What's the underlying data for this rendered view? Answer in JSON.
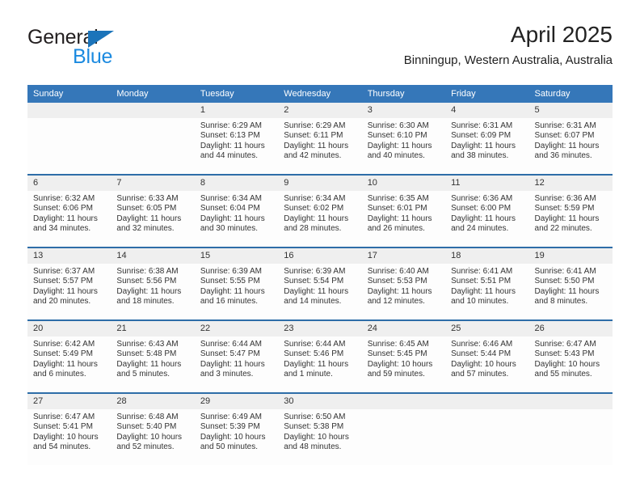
{
  "brand": {
    "name_top": "General",
    "name_bottom": "Blue",
    "accent_dark": "#1b74ba",
    "accent_light": "#1b8ae0"
  },
  "header": {
    "title": "April 2025",
    "subtitle": "Binningup, Western Australia, Australia"
  },
  "theme": {
    "header_bg": "#3577b9",
    "row_border": "#2e6da8",
    "daynum_bg": "#efefef",
    "text": "#333333"
  },
  "weekday_headers": [
    "Sunday",
    "Monday",
    "Tuesday",
    "Wednesday",
    "Thursday",
    "Friday",
    "Saturday"
  ],
  "labels": {
    "sunrise_prefix": "Sunrise:",
    "sunset_prefix": "Sunset:",
    "daylight_prefix": "Daylight:"
  },
  "weeks": [
    [
      {
        "day": "",
        "empty": true
      },
      {
        "day": "",
        "empty": true
      },
      {
        "day": "1",
        "sunrise": "Sunrise: 6:29 AM",
        "sunset": "Sunset: 6:13 PM",
        "daylight_line1": "Daylight: 11 hours",
        "daylight_line2": "and 44 minutes."
      },
      {
        "day": "2",
        "sunrise": "Sunrise: 6:29 AM",
        "sunset": "Sunset: 6:11 PM",
        "daylight_line1": "Daylight: 11 hours",
        "daylight_line2": "and 42 minutes."
      },
      {
        "day": "3",
        "sunrise": "Sunrise: 6:30 AM",
        "sunset": "Sunset: 6:10 PM",
        "daylight_line1": "Daylight: 11 hours",
        "daylight_line2": "and 40 minutes."
      },
      {
        "day": "4",
        "sunrise": "Sunrise: 6:31 AM",
        "sunset": "Sunset: 6:09 PM",
        "daylight_line1": "Daylight: 11 hours",
        "daylight_line2": "and 38 minutes."
      },
      {
        "day": "5",
        "sunrise": "Sunrise: 6:31 AM",
        "sunset": "Sunset: 6:07 PM",
        "daylight_line1": "Daylight: 11 hours",
        "daylight_line2": "and 36 minutes."
      }
    ],
    [
      {
        "day": "6",
        "sunrise": "Sunrise: 6:32 AM",
        "sunset": "Sunset: 6:06 PM",
        "daylight_line1": "Daylight: 11 hours",
        "daylight_line2": "and 34 minutes."
      },
      {
        "day": "7",
        "sunrise": "Sunrise: 6:33 AM",
        "sunset": "Sunset: 6:05 PM",
        "daylight_line1": "Daylight: 11 hours",
        "daylight_line2": "and 32 minutes."
      },
      {
        "day": "8",
        "sunrise": "Sunrise: 6:34 AM",
        "sunset": "Sunset: 6:04 PM",
        "daylight_line1": "Daylight: 11 hours",
        "daylight_line2": "and 30 minutes."
      },
      {
        "day": "9",
        "sunrise": "Sunrise: 6:34 AM",
        "sunset": "Sunset: 6:02 PM",
        "daylight_line1": "Daylight: 11 hours",
        "daylight_line2": "and 28 minutes."
      },
      {
        "day": "10",
        "sunrise": "Sunrise: 6:35 AM",
        "sunset": "Sunset: 6:01 PM",
        "daylight_line1": "Daylight: 11 hours",
        "daylight_line2": "and 26 minutes."
      },
      {
        "day": "11",
        "sunrise": "Sunrise: 6:36 AM",
        "sunset": "Sunset: 6:00 PM",
        "daylight_line1": "Daylight: 11 hours",
        "daylight_line2": "and 24 minutes."
      },
      {
        "day": "12",
        "sunrise": "Sunrise: 6:36 AM",
        "sunset": "Sunset: 5:59 PM",
        "daylight_line1": "Daylight: 11 hours",
        "daylight_line2": "and 22 minutes."
      }
    ],
    [
      {
        "day": "13",
        "sunrise": "Sunrise: 6:37 AM",
        "sunset": "Sunset: 5:57 PM",
        "daylight_line1": "Daylight: 11 hours",
        "daylight_line2": "and 20 minutes."
      },
      {
        "day": "14",
        "sunrise": "Sunrise: 6:38 AM",
        "sunset": "Sunset: 5:56 PM",
        "daylight_line1": "Daylight: 11 hours",
        "daylight_line2": "and 18 minutes."
      },
      {
        "day": "15",
        "sunrise": "Sunrise: 6:39 AM",
        "sunset": "Sunset: 5:55 PM",
        "daylight_line1": "Daylight: 11 hours",
        "daylight_line2": "and 16 minutes."
      },
      {
        "day": "16",
        "sunrise": "Sunrise: 6:39 AM",
        "sunset": "Sunset: 5:54 PM",
        "daylight_line1": "Daylight: 11 hours",
        "daylight_line2": "and 14 minutes."
      },
      {
        "day": "17",
        "sunrise": "Sunrise: 6:40 AM",
        "sunset": "Sunset: 5:53 PM",
        "daylight_line1": "Daylight: 11 hours",
        "daylight_line2": "and 12 minutes."
      },
      {
        "day": "18",
        "sunrise": "Sunrise: 6:41 AM",
        "sunset": "Sunset: 5:51 PM",
        "daylight_line1": "Daylight: 11 hours",
        "daylight_line2": "and 10 minutes."
      },
      {
        "day": "19",
        "sunrise": "Sunrise: 6:41 AM",
        "sunset": "Sunset: 5:50 PM",
        "daylight_line1": "Daylight: 11 hours",
        "daylight_line2": "and 8 minutes."
      }
    ],
    [
      {
        "day": "20",
        "sunrise": "Sunrise: 6:42 AM",
        "sunset": "Sunset: 5:49 PM",
        "daylight_line1": "Daylight: 11 hours",
        "daylight_line2": "and 6 minutes."
      },
      {
        "day": "21",
        "sunrise": "Sunrise: 6:43 AM",
        "sunset": "Sunset: 5:48 PM",
        "daylight_line1": "Daylight: 11 hours",
        "daylight_line2": "and 5 minutes."
      },
      {
        "day": "22",
        "sunrise": "Sunrise: 6:44 AM",
        "sunset": "Sunset: 5:47 PM",
        "daylight_line1": "Daylight: 11 hours",
        "daylight_line2": "and 3 minutes."
      },
      {
        "day": "23",
        "sunrise": "Sunrise: 6:44 AM",
        "sunset": "Sunset: 5:46 PM",
        "daylight_line1": "Daylight: 11 hours",
        "daylight_line2": "and 1 minute."
      },
      {
        "day": "24",
        "sunrise": "Sunrise: 6:45 AM",
        "sunset": "Sunset: 5:45 PM",
        "daylight_line1": "Daylight: 10 hours",
        "daylight_line2": "and 59 minutes."
      },
      {
        "day": "25",
        "sunrise": "Sunrise: 6:46 AM",
        "sunset": "Sunset: 5:44 PM",
        "daylight_line1": "Daylight: 10 hours",
        "daylight_line2": "and 57 minutes."
      },
      {
        "day": "26",
        "sunrise": "Sunrise: 6:47 AM",
        "sunset": "Sunset: 5:43 PM",
        "daylight_line1": "Daylight: 10 hours",
        "daylight_line2": "and 55 minutes."
      }
    ],
    [
      {
        "day": "27",
        "sunrise": "Sunrise: 6:47 AM",
        "sunset": "Sunset: 5:41 PM",
        "daylight_line1": "Daylight: 10 hours",
        "daylight_line2": "and 54 minutes."
      },
      {
        "day": "28",
        "sunrise": "Sunrise: 6:48 AM",
        "sunset": "Sunset: 5:40 PM",
        "daylight_line1": "Daylight: 10 hours",
        "daylight_line2": "and 52 minutes."
      },
      {
        "day": "29",
        "sunrise": "Sunrise: 6:49 AM",
        "sunset": "Sunset: 5:39 PM",
        "daylight_line1": "Daylight: 10 hours",
        "daylight_line2": "and 50 minutes."
      },
      {
        "day": "30",
        "sunrise": "Sunrise: 6:50 AM",
        "sunset": "Sunset: 5:38 PM",
        "daylight_line1": "Daylight: 10 hours",
        "daylight_line2": "and 48 minutes."
      },
      {
        "day": "",
        "empty": true
      },
      {
        "day": "",
        "empty": true
      },
      {
        "day": "",
        "empty": true
      }
    ]
  ]
}
